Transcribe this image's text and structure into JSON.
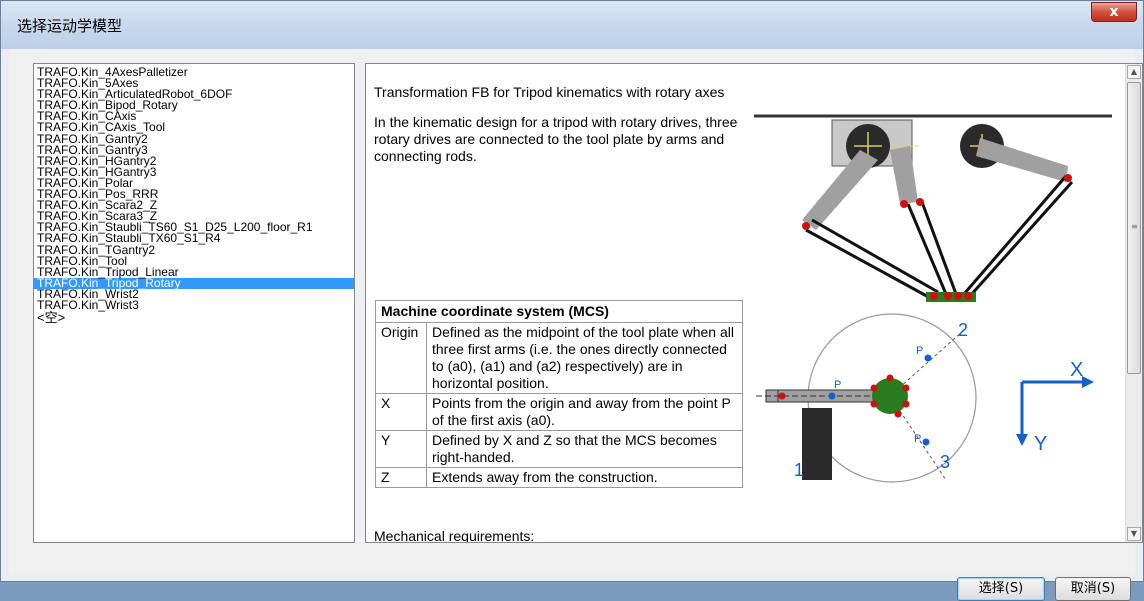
{
  "window": {
    "title": "选择运动学模型",
    "close_label": "x"
  },
  "kinematics_list": {
    "items": [
      "TRAFO.Kin_4AxesPalletizer",
      "TRAFO.Kin_5Axes",
      "TRAFO.Kin_ArticulatedRobot_6DOF",
      "TRAFO.Kin_Bipod_Rotary",
      "TRAFO.Kin_CAxis",
      "TRAFO.Kin_CAxis_Tool",
      "TRAFO.Kin_Gantry2",
      "TRAFO.Kin_Gantry3",
      "TRAFO.Kin_HGantry2",
      "TRAFO.Kin_HGantry3",
      "TRAFO.Kin_Polar",
      "TRAFO.Kin_Pos_RRR",
      "TRAFO.Kin_Scara2_Z",
      "TRAFO.Kin_Scara3_Z",
      "TRAFO.Kin_Staubli_TS60_S1_D25_L200_floor_R1",
      "TRAFO.Kin_Staubli_TX60_S1_R4",
      "TRAFO.Kin_TGantry2",
      "TRAFO.Kin_Tool",
      "TRAFO.Kin_Tripod_Linear",
      "TRAFO.Kin_Tripod_Rotary",
      "TRAFO.Kin_Wrist2",
      "TRAFO.Kin_Wrist3"
    ],
    "empty_item": "<空>",
    "selected_index": 19
  },
  "help": {
    "title": "Transformation FB for Tripod kinematics with rotary axes",
    "intro": "In the kinematic design for a tripod with rotary drives, three rotary drives are connected to the tool plate by arms and connecting rods.",
    "mcs_table": {
      "header": "Machine coordinate system (MCS)",
      "rows": [
        {
          "key": "Origin",
          "value": "Defined as the midpoint of the tool plate when all three first arms (i.e. the ones directly connected to (a0), (a1) and (a2) respectively) are in horizontal position."
        },
        {
          "key": "X",
          "value": "Points from the origin and away from the point P of the first axis (a0)."
        },
        {
          "key": "Y",
          "value": "Defined by X and Z so that the MCS becomes right-handed."
        },
        {
          "key": "Z",
          "value": "Extends away from the construction."
        }
      ]
    },
    "mechanical_heading": "Mechanical requirements:",
    "diagram_labels": {
      "p": "P",
      "axis1": "1",
      "axis2": "2",
      "axis3": "3",
      "x_axis": "X",
      "y_axis": "Y"
    }
  },
  "buttons": {
    "select": "选择(S)",
    "cancel": "取消(S)"
  },
  "colors": {
    "selection": "#3399ff",
    "axis_blue": "#1060d0",
    "plate_green": "#2a7a1e",
    "joint_red": "#cc1111"
  }
}
